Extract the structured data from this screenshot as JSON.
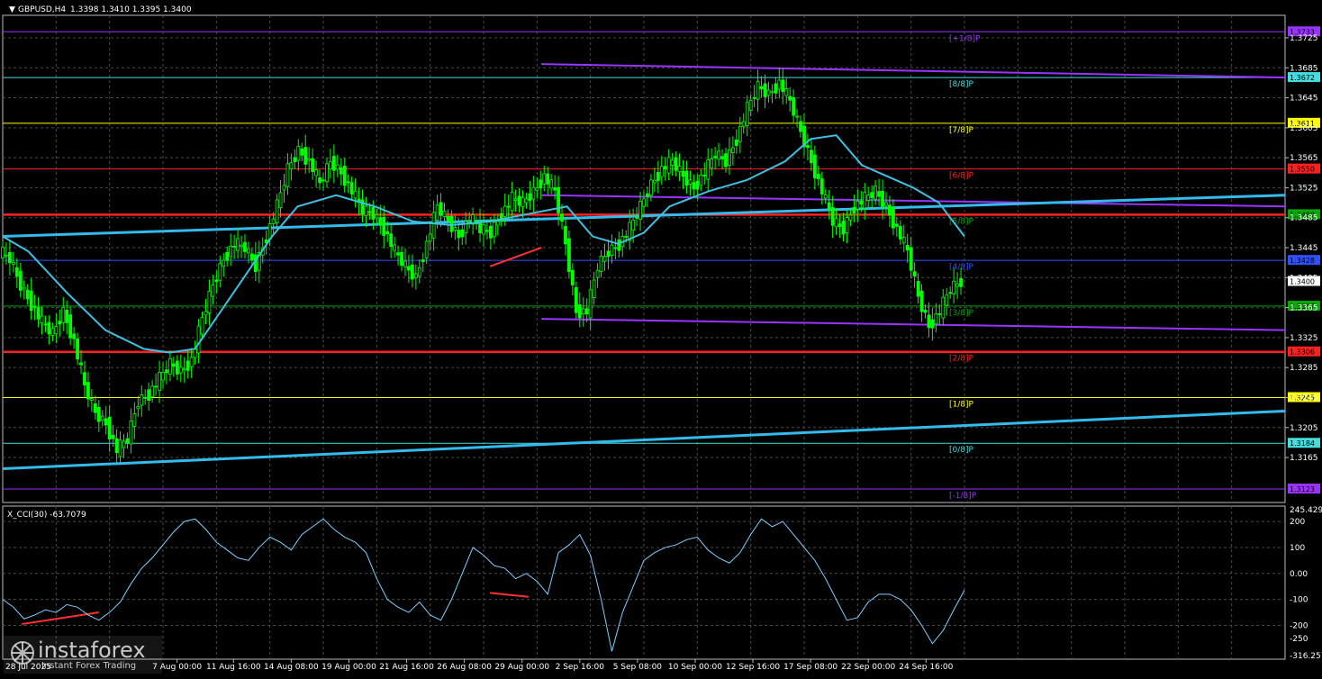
{
  "header": {
    "symbol": "GBPUSD,H4",
    "ohlc": "1.3398 1.3410 1.3395 1.3400"
  },
  "indicator": {
    "label": "X_CCI(30) -63.7079"
  },
  "watermark": {
    "brand": "instaforex",
    "tagline": "Instant Forex Trading"
  },
  "colors": {
    "background": "#000000",
    "grid": "#4a4a4a",
    "bull_candle": "#00ff00",
    "bear_candle": "#00ff00",
    "moving_average": "#3fc0e0",
    "trendline": "#33bbee",
    "channel": "#9933ff",
    "cci_line": "#7fd0ff",
    "divergence": "#ff3030"
  },
  "chart_data": {
    "type": "candlestick",
    "symbol": "GBPUSD",
    "timeframe": "H4",
    "ylim": [
      1.3105,
      1.3755
    ],
    "y_ticks": [
      "1.3725",
      "1.3685",
      "1.3645",
      "1.3605",
      "1.3565",
      "1.3525",
      "1.3485",
      "1.3445",
      "1.3405",
      "1.3365",
      "1.3325",
      "1.3285",
      "1.3245",
      "1.3205",
      "1.3165"
    ],
    "x_ticks": [
      "7 Aug 00:00",
      "11 Aug 16:00",
      "14 Aug 08:00",
      "19 Aug 00:00",
      "21 Aug 16:00",
      "26 Aug 08:00",
      "29 Aug 00:00",
      "2 Sep 16:00",
      "5 Sep 08:00",
      "10 Sep 00:00",
      "12 Sep 16:00",
      "17 Sep 08:00",
      "22 Sep 00:00",
      "24 Sep 16:00"
    ],
    "x_tick_first_partial": "28 Jul 2025",
    "current_price": "1.3400",
    "murray_levels": [
      {
        "label": "[+1/8]P",
        "price": "1.3733",
        "color": "#9933ff",
        "value": 1.3733
      },
      {
        "label": "[8/8]P",
        "price": "1.3672",
        "color": "#44dddd",
        "value": 1.3672
      },
      {
        "label": "[7/8]P",
        "price": "1.3611",
        "color": "#ffff00",
        "value": 1.3611
      },
      {
        "label": "[6/8]P",
        "price": "1.3550",
        "color": "#ff2020",
        "value": 1.355
      },
      {
        "label": "[5/8]P",
        "price": "1.3489",
        "color": "#00aa00",
        "value": 1.3489
      },
      {
        "label": "[4/8]P",
        "price": "1.3428",
        "color": "#3050ff",
        "value": 1.3428
      },
      {
        "label": "[3/8]P",
        "price": "1.3367",
        "color": "#00aa00",
        "value": 1.3367
      },
      {
        "label": "[2/8]P",
        "price": "1.3306",
        "color": "#ff2020",
        "value": 1.3306
      },
      {
        "label": "[1/8]P",
        "price": "1.3245",
        "color": "#ffff00",
        "value": 1.3245
      },
      {
        "label": "[0/8]P",
        "price": "1.3184",
        "color": "#44dddd",
        "value": 1.3184
      },
      {
        "label": "[-1/8]P",
        "price": "1.3123",
        "color": "#9933ff",
        "value": 1.3123
      }
    ],
    "red_thick_lines": [
      1.3489,
      1.3306
    ],
    "trendlines": [
      {
        "name": "",
        "from": [
          0,
          1.346
        ],
        "to": [
          1,
          1.3515
        ]
      },
      {
        "name": "",
        "from": [
          0,
          1.315
        ],
        "to": [
          1,
          1.3227
        ]
      }
    ],
    "channel_lines": [
      {
        "from": [
          0.42,
          1.369
        ],
        "to": [
          1,
          1.3672
        ]
      },
      {
        "from": [
          0.42,
          1.3515
        ],
        "to": [
          1,
          1.35
        ]
      },
      {
        "from": [
          0.42,
          1.335
        ],
        "to": [
          1,
          1.3335
        ]
      }
    ],
    "moving_average": [
      [
        0,
        1.346
      ],
      [
        0.02,
        1.344
      ],
      [
        0.05,
        1.3385
      ],
      [
        0.08,
        1.3335
      ],
      [
        0.11,
        1.331
      ],
      [
        0.13,
        1.3305
      ],
      [
        0.15,
        1.331
      ],
      [
        0.17,
        1.336
      ],
      [
        0.19,
        1.341
      ],
      [
        0.21,
        1.346
      ],
      [
        0.23,
        1.35
      ],
      [
        0.26,
        1.3515
      ],
      [
        0.29,
        1.35
      ],
      [
        0.32,
        1.348
      ],
      [
        0.35,
        1.3475
      ],
      [
        0.38,
        1.348
      ],
      [
        0.41,
        1.349
      ],
      [
        0.44,
        1.35
      ],
      [
        0.46,
        1.346
      ],
      [
        0.48,
        1.345
      ],
      [
        0.5,
        1.3465
      ],
      [
        0.52,
        1.35
      ],
      [
        0.55,
        1.352
      ],
      [
        0.58,
        1.3535
      ],
      [
        0.61,
        1.356
      ],
      [
        0.63,
        1.359
      ],
      [
        0.65,
        1.3595
      ],
      [
        0.67,
        1.3555
      ],
      [
        0.69,
        1.354
      ],
      [
        0.71,
        1.3525
      ],
      [
        0.73,
        1.3505
      ],
      [
        0.75,
        1.346
      ]
    ],
    "candles_closes": [
      1.344,
      1.343,
      1.3395,
      1.337,
      1.3345,
      1.333,
      1.336,
      1.332,
      1.326,
      1.3225,
      1.321,
      1.3175,
      1.319,
      1.324,
      1.325,
      1.327,
      1.329,
      1.328,
      1.3295,
      1.335,
      1.3395,
      1.343,
      1.345,
      1.3445,
      1.342,
      1.346,
      1.35,
      1.355,
      1.3575,
      1.356,
      1.353,
      1.356,
      1.3545,
      1.352,
      1.3495,
      1.349,
      1.347,
      1.344,
      1.342,
      1.3405,
      1.345,
      1.35,
      1.348,
      1.346,
      1.3485,
      1.347,
      1.3465,
      1.349,
      1.351,
      1.3505,
      1.352,
      1.354,
      1.352,
      1.345,
      1.336,
      1.336,
      1.342,
      1.344,
      1.345,
      1.347,
      1.35,
      1.353,
      1.355,
      1.356,
      1.354,
      1.3525,
      1.3545,
      1.357,
      1.356,
      1.359,
      1.363,
      1.366,
      1.365,
      1.3665,
      1.364,
      1.36,
      1.356,
      1.352,
      1.348,
      1.347,
      1.35,
      1.351,
      1.352,
      1.35,
      1.347,
      1.344,
      1.338,
      1.334,
      1.336,
      1.339,
      1.34
    ],
    "cci": {
      "label": "X_CCI(30)",
      "current_value": -63.7079,
      "ylim": [
        -316.257,
        245.429
      ],
      "y_ticks": [
        "245.429",
        "200",
        "100",
        "0.00",
        "-100",
        "-200",
        "-250",
        "-316.257"
      ],
      "values": [
        -100,
        -130,
        -175,
        -160,
        -140,
        -150,
        -120,
        -130,
        -160,
        -180,
        -150,
        -110,
        -40,
        20,
        60,
        110,
        160,
        200,
        210,
        170,
        120,
        90,
        60,
        50,
        100,
        140,
        120,
        90,
        150,
        180,
        210,
        170,
        140,
        120,
        80,
        -20,
        -100,
        -130,
        -150,
        -110,
        -160,
        -180,
        -100,
        0,
        100,
        70,
        30,
        20,
        -20,
        0,
        -30,
        -80,
        80,
        110,
        150,
        70,
        -100,
        -300,
        -150,
        -50,
        50,
        80,
        100,
        110,
        130,
        140,
        90,
        60,
        40,
        80,
        150,
        210,
        180,
        200,
        150,
        100,
        50,
        -20,
        -100,
        -180,
        -170,
        -110,
        -80,
        -80,
        -100,
        -140,
        -200,
        -270,
        -220,
        -140,
        -64
      ]
    },
    "divergence_lines": [
      {
        "panel": "price",
        "from": [
          0.38,
          1.342
        ],
        "to": [
          0.42,
          1.3445
        ]
      },
      {
        "panel": "cci",
        "from": [
          0.015,
          -195
        ],
        "to": [
          0.075,
          -150
        ]
      },
      {
        "panel": "cci",
        "from": [
          0.38,
          -75
        ],
        "to": [
          0.41,
          -90
        ]
      }
    ]
  }
}
